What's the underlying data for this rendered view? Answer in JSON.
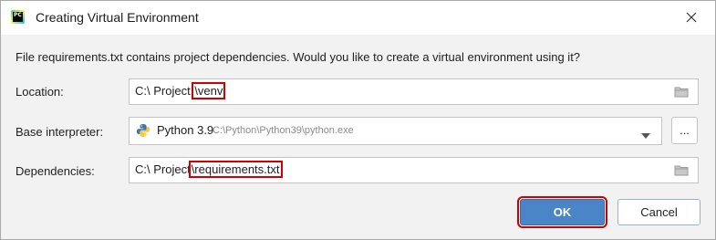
{
  "window": {
    "title": "Creating Virtual Environment",
    "app_icon_text": "PC",
    "close_icon": "close-icon"
  },
  "message": "File requirements.txt contains project dependencies. Would you like to create a virtual environment using it?",
  "location": {
    "label": "Location:",
    "prefix": "C:\\ Project",
    "highlighted": "\\venv",
    "browse_icon": "folder-icon"
  },
  "base_interpreter": {
    "label": "Base interpreter:",
    "version": "Python 3.9",
    "path": "C:\\Python\\Python39\\python.exe",
    "icon": "python-icon",
    "more_button": "..."
  },
  "dependencies": {
    "label": "Dependencies:",
    "prefix": "C:\\ Project",
    "highlighted": "\\requirements.txt",
    "browse_icon": "folder-icon"
  },
  "buttons": {
    "ok": "OK",
    "cancel": "Cancel"
  },
  "colors": {
    "ok_button": "#4a86c7",
    "highlight": "#d00000",
    "dialog_bg": "#f2f2f2"
  }
}
